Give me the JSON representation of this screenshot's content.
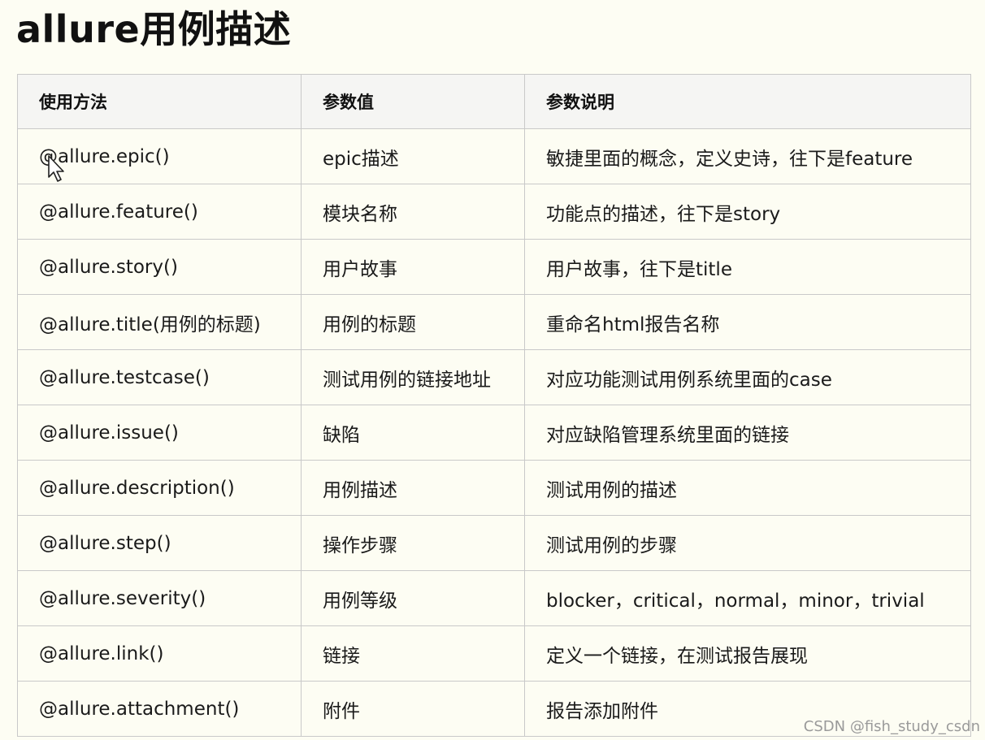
{
  "title": "allure用例描述",
  "table": {
    "headers": [
      "使用方法",
      "参数值",
      "参数说明"
    ],
    "rows": [
      [
        "@allure.epic()",
        "epic描述",
        "敏捷里面的概念，定义史诗，往下是feature"
      ],
      [
        "@allure.feature()",
        "模块名称",
        "功能点的描述，往下是story"
      ],
      [
        "@allure.story()",
        "用户故事",
        "用户故事，往下是title"
      ],
      [
        "@allure.title(用例的标题)",
        "用例的标题",
        "重命名html报告名称"
      ],
      [
        "@allure.testcase()",
        "测试用例的链接地址",
        "对应功能测试用例系统里面的case"
      ],
      [
        "@allure.issue()",
        "缺陷",
        "对应缺陷管理系统里面的链接"
      ],
      [
        "@allure.description()",
        "用例描述",
        "测试用例的描述"
      ],
      [
        "@allure.step()",
        "操作步骤",
        "测试用例的步骤"
      ],
      [
        "@allure.severity()",
        "用例等级",
        "blocker，critical，normal，minor，trivial"
      ],
      [
        "@allure.link()",
        "链接",
        "定义一个链接，在测试报告展现"
      ],
      [
        "@allure.attachment()",
        "附件",
        "报告添加附件"
      ]
    ]
  },
  "watermark": "CSDN @fish_study_csdn",
  "cursor_icon": "mouse-pointer-icon"
}
